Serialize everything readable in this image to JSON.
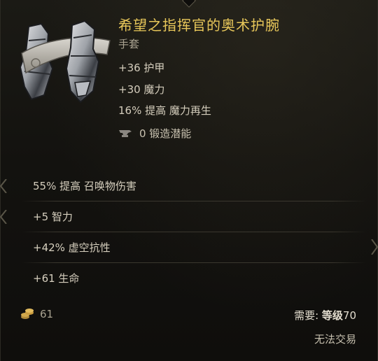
{
  "item": {
    "name": "希望之指挥官的奥术护腕",
    "type": "手套",
    "implicits": [
      "+36 护甲",
      "+30 魔力",
      "16% 提高 魔力再生"
    ],
    "forge_potential": "0 锻造潜能"
  },
  "affixes": [
    "55% 提高 召唤物伤害",
    "+5 智力",
    "+42% 虚空抗性",
    "+61 生命"
  ],
  "footer": {
    "gold_value": "61",
    "requirement_label": "需要: ",
    "requirement_level": "等级",
    "requirement_value": "70",
    "trade_status": "无法交易"
  },
  "colors": {
    "title": "#e8c75a",
    "text": "#d4cdbc",
    "subtle": "#a9a290"
  }
}
